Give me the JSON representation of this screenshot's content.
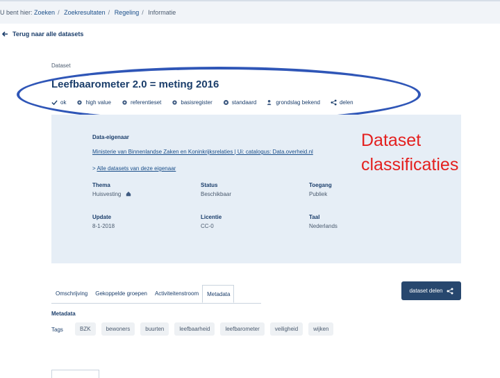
{
  "breadcrumb": {
    "prefix": "U bent hier:",
    "items": [
      "Zoeken",
      "Zoekresultaten",
      "Regeling",
      "Informatie"
    ]
  },
  "back_link": "Terug naar alle datasets",
  "dataset": {
    "label": "Dataset",
    "title": "Leefbaarometer 2.0 = meting 2016",
    "classifications": [
      {
        "icon": "check-icon",
        "label": "ok"
      },
      {
        "icon": "gear-icon",
        "label": "high value"
      },
      {
        "icon": "gear-icon",
        "label": "referentieset"
      },
      {
        "icon": "gear-icon",
        "label": "basisregister"
      },
      {
        "icon": "disc-icon",
        "label": "standaard"
      },
      {
        "icon": "person-icon",
        "label": "grondslag bekend"
      },
      {
        "icon": "share-icon",
        "label": "delen"
      }
    ]
  },
  "owner": {
    "heading": "Data-eigenaar",
    "link": "Ministerie van Binnenlandse Zaken en Koninkrijksrelaties | Ui: catalogus: Data.overheid.nl",
    "all_prefix": ">",
    "all_link": "Alle datasets van deze eigenaar"
  },
  "fields": {
    "thema": {
      "label": "Thema",
      "value": "Huisvesting"
    },
    "status": {
      "label": "Status",
      "value": "Beschikbaar"
    },
    "toegang": {
      "label": "Toegang",
      "value": "Publiek"
    },
    "update": {
      "label": "Update",
      "value": "8-1-2018"
    },
    "licentie": {
      "label": "Licentie",
      "value": "CC-0"
    },
    "taal": {
      "label": "Taal",
      "value": "Nederlands"
    }
  },
  "annotation": {
    "line1": "Dataset",
    "line2": "classificaties"
  },
  "tabs": [
    "Omschrijving",
    "Gekoppelde groepen",
    "Activiteitenstroom",
    "Metadata"
  ],
  "share_button": "dataset delen",
  "metadata": {
    "heading": "Metadata",
    "tags_label": "Tags",
    "tags": [
      "BZK",
      "bewoners",
      "buurten",
      "leefbaarheid",
      "leefbarometer",
      "veiligheid",
      "wijken"
    ]
  },
  "colors": {
    "annotation": "#e4201f",
    "ellipse": "#2f56b7",
    "panel": "#e6eef6",
    "button": "#27476e"
  }
}
